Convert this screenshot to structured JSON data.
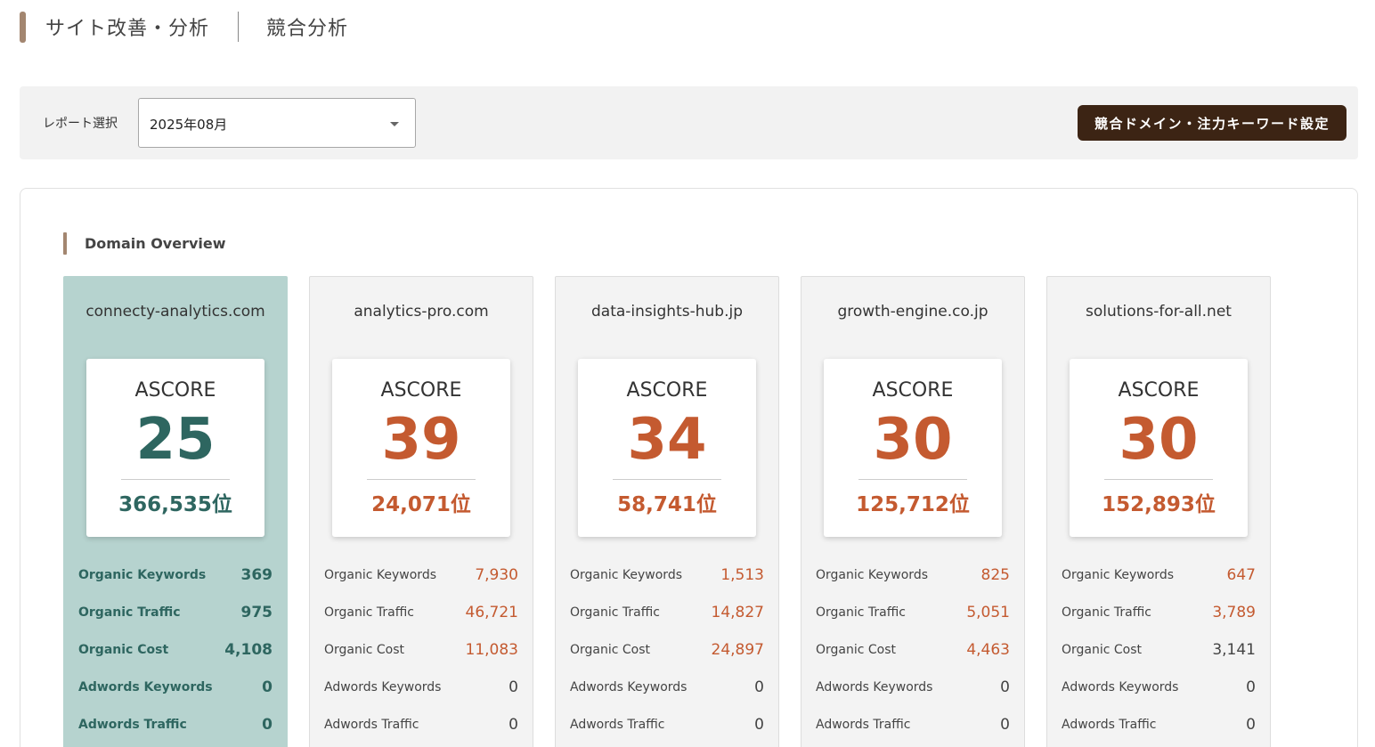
{
  "header": {
    "title": "サイト改善・分析",
    "subtitle": "競合分析"
  },
  "filter": {
    "label": "レポート選択",
    "report_value": "2025年08月",
    "settings_button": "競合ドメイン・注力キーワード設定"
  },
  "overview": {
    "title": "Domain Overview",
    "score_label": "ASCORE",
    "domains": [
      {
        "name": "connecty-analytics.com",
        "ascore": "25",
        "rank": "366,535位",
        "metrics": [
          {
            "label": "Organic Keywords",
            "value": "369",
            "highlight": false
          },
          {
            "label": "Organic Traffic",
            "value": "975",
            "highlight": false
          },
          {
            "label": "Organic Cost",
            "value": "4,108",
            "highlight": false
          },
          {
            "label": "Adwords Keywords",
            "value": "0",
            "highlight": false
          },
          {
            "label": "Adwords Traffic",
            "value": "0",
            "highlight": false
          }
        ]
      },
      {
        "name": "analytics-pro.com",
        "ascore": "39",
        "rank": "24,071位",
        "metrics": [
          {
            "label": "Organic Keywords",
            "value": "7,930",
            "highlight": true
          },
          {
            "label": "Organic Traffic",
            "value": "46,721",
            "highlight": true
          },
          {
            "label": "Organic Cost",
            "value": "11,083",
            "highlight": true
          },
          {
            "label": "Adwords Keywords",
            "value": "0",
            "highlight": false
          },
          {
            "label": "Adwords Traffic",
            "value": "0",
            "highlight": false
          }
        ]
      },
      {
        "name": "data-insights-hub.jp",
        "ascore": "34",
        "rank": "58,741位",
        "metrics": [
          {
            "label": "Organic Keywords",
            "value": "1,513",
            "highlight": true
          },
          {
            "label": "Organic Traffic",
            "value": "14,827",
            "highlight": true
          },
          {
            "label": "Organic Cost",
            "value": "24,897",
            "highlight": true
          },
          {
            "label": "Adwords Keywords",
            "value": "0",
            "highlight": false
          },
          {
            "label": "Adwords Traffic",
            "value": "0",
            "highlight": false
          }
        ]
      },
      {
        "name": "growth-engine.co.jp",
        "ascore": "30",
        "rank": "125,712位",
        "metrics": [
          {
            "label": "Organic Keywords",
            "value": "825",
            "highlight": true
          },
          {
            "label": "Organic Traffic",
            "value": "5,051",
            "highlight": true
          },
          {
            "label": "Organic Cost",
            "value": "4,463",
            "highlight": true
          },
          {
            "label": "Adwords Keywords",
            "value": "0",
            "highlight": false
          },
          {
            "label": "Adwords Traffic",
            "value": "0",
            "highlight": false
          }
        ]
      },
      {
        "name": "solutions-for-all.net",
        "ascore": "30",
        "rank": "152,893位",
        "metrics": [
          {
            "label": "Organic Keywords",
            "value": "647",
            "highlight": true
          },
          {
            "label": "Organic Traffic",
            "value": "3,789",
            "highlight": true
          },
          {
            "label": "Organic Cost",
            "value": "3,141",
            "highlight": false
          },
          {
            "label": "Adwords Keywords",
            "value": "0",
            "highlight": false
          },
          {
            "label": "Adwords Traffic",
            "value": "0",
            "highlight": false
          }
        ]
      }
    ]
  },
  "colors": {
    "accent_brown": "#a38670",
    "button_dark_brown": "#3c2414",
    "own_card_bg": "#b6d3cf",
    "own_text_teal": "#2e6660",
    "competitor_orange": "#c45a30"
  }
}
